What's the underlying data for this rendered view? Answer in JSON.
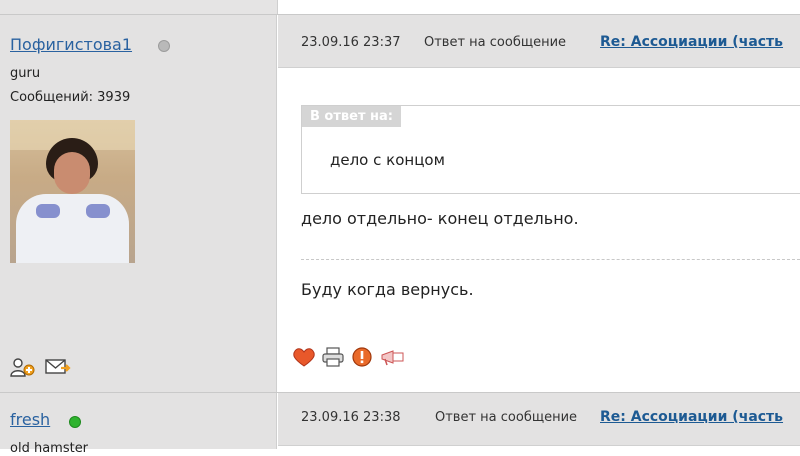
{
  "posts": [
    {
      "author": {
        "name": "Пофигистова1",
        "status": "offline",
        "status_color": "#b7b7b7",
        "rank": "guru",
        "messages": "Сообщений: 3939",
        "avatar_icon": "user-avatar-photo"
      },
      "header": {
        "date": "23.09.16 23:37",
        "reply_label": "Ответ на сообщение",
        "topic_link": "Re: Ассоциации (часть"
      },
      "quote": {
        "label": "В ответ на:",
        "text": "дело с концом"
      },
      "body": "дело отдельно- конец отдельно.",
      "signature": "Буду когда вернусь.",
      "actions": [
        "like-heart-icon",
        "print-icon",
        "report-icon",
        "megaphone-icon"
      ],
      "author_actions": [
        "add-friend-icon",
        "send-message-icon"
      ]
    },
    {
      "author": {
        "name": "fresh",
        "status": "online",
        "status_color": "#2fb32f",
        "rank": "old hamster"
      },
      "header": {
        "date": "23.09.16 23:38",
        "reply_label": "Ответ на сообщение",
        "topic_link": "Re: Ассоциации (часть"
      }
    }
  ],
  "colors": {
    "link": "#1d5a93",
    "panel": "#e3e2e2"
  }
}
